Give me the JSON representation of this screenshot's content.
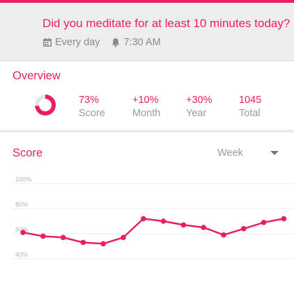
{
  "habit": {
    "question": "Did you meditate for at least 10 minutes today?",
    "frequency": "Every day",
    "reminder": "7:30 AM",
    "frequency_icon": "calendar-icon",
    "reminder_icon": "bell-icon"
  },
  "overview": {
    "title": "Overview",
    "score_fraction": 0.73,
    "stats": [
      {
        "value": "73%",
        "label": "Score"
      },
      {
        "value": "+10%",
        "label": "Month"
      },
      {
        "value": "+30%",
        "label": "Year"
      },
      {
        "value": "1045",
        "label": "Total"
      }
    ]
  },
  "score": {
    "title": "Score",
    "period": "Week",
    "dropdown_icon": "caret-down-icon"
  },
  "colors": {
    "accent": "#e91e63",
    "muted_text": "#9a9a9a",
    "ring_track": "#e6e6e6"
  },
  "chart_data": {
    "type": "line",
    "ytick_labels": [
      "100%",
      "80%",
      "60%",
      "40%"
    ],
    "ylim": [
      40,
      100
    ],
    "grid": true,
    "values": [
      61,
      58,
      57,
      53,
      52,
      57,
      72,
      70,
      67,
      65,
      59,
      64,
      69,
      72
    ]
  }
}
